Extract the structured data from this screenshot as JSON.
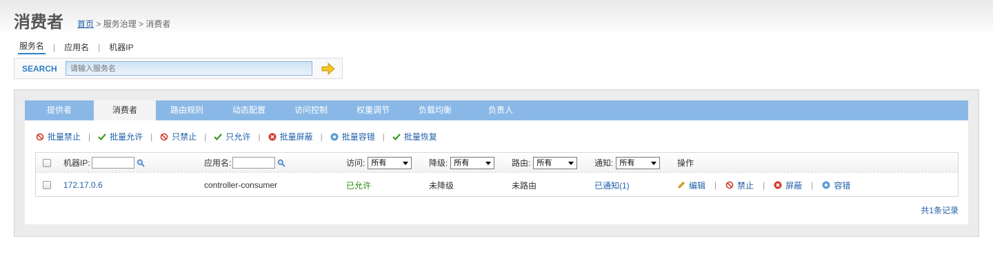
{
  "page": {
    "title": "消费者",
    "breadcrumb": {
      "home": "首页",
      "rest": " > 服务治理 > 消费者"
    }
  },
  "search": {
    "tabs": [
      "服务名",
      "应用名",
      "机器IP"
    ],
    "label": "SEARCH",
    "placeholder": "请输入服务名"
  },
  "tabs": [
    "提供者",
    "消费者",
    "路由规则",
    "动态配置",
    "访问控制",
    "权重调节",
    "负载均衡",
    "负责人"
  ],
  "batch_actions": [
    "批量禁止",
    "批量允许",
    "只禁止",
    "只允许",
    "批量屏蔽",
    "批量容错",
    "批量恢复"
  ],
  "table": {
    "headers": {
      "machine_ip": "机器IP:",
      "app_name": "应用名:",
      "access": "访问:",
      "degrade": "降级:",
      "route": "路由:",
      "notify": "通知:",
      "operation": "操作"
    },
    "select_default": "所有",
    "rows": [
      {
        "ip": "172.17.0.6",
        "app": "controller-consumer",
        "access": "已允许",
        "degrade": "未降级",
        "route": "未路由",
        "notify": "已通知(1)",
        "ops": [
          "编辑",
          "禁止",
          "屏蔽",
          "容错"
        ]
      }
    ]
  },
  "total": "共1条记录",
  "colors": {
    "tab_bar": "#8ab8e6",
    "link": "#1f5fa8",
    "allowed": "#2a8a16",
    "forbid_red": "#d23a2a"
  }
}
